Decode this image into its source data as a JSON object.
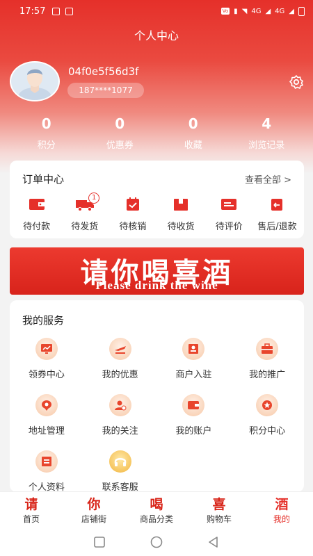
{
  "status_bar": {
    "time": "17:57",
    "network_labels": [
      "4G",
      "4G"
    ]
  },
  "page_title": "个人中心",
  "user": {
    "name": "04f0e5f56d3f",
    "phone": "187****1077"
  },
  "stats": [
    {
      "value": "0",
      "label": "积分"
    },
    {
      "value": "0",
      "label": "优惠券"
    },
    {
      "value": "0",
      "label": "收藏"
    },
    {
      "value": "4",
      "label": "浏览记录"
    }
  ],
  "orders": {
    "title": "订单中心",
    "see_all": "查看全部 >",
    "items": [
      {
        "label": "待付款",
        "icon": "wallet-icon"
      },
      {
        "label": "待发货",
        "icon": "truck-icon",
        "badge": "1"
      },
      {
        "label": "待核销",
        "icon": "calendar-check-icon"
      },
      {
        "label": "待收货",
        "icon": "box-icon"
      },
      {
        "label": "待评价",
        "icon": "message-icon"
      },
      {
        "label": "售后/退款",
        "icon": "return-icon"
      }
    ]
  },
  "banner": {
    "title": "请你喝喜酒",
    "subtitle": "Please drink the wine"
  },
  "services": {
    "title": "我的服务",
    "items": [
      {
        "label": "领券中心",
        "icon": "monitor-icon"
      },
      {
        "label": "我的优惠",
        "icon": "plane-icon"
      },
      {
        "label": "商户入驻",
        "icon": "id-card-icon"
      },
      {
        "label": "我的推广",
        "icon": "briefcase-icon"
      },
      {
        "label": "地址管理",
        "icon": "location-icon"
      },
      {
        "label": "我的关注",
        "icon": "user-check-icon"
      },
      {
        "label": "我的账户",
        "icon": "wallet-icon"
      },
      {
        "label": "积分中心",
        "icon": "medal-icon"
      },
      {
        "label": "个人资料",
        "icon": "profile-card-icon"
      },
      {
        "label": "联系客服",
        "icon": "headset-icon"
      }
    ]
  },
  "tabbar": [
    {
      "glyph": "请",
      "label": "首页"
    },
    {
      "glyph": "你",
      "label": "店铺街"
    },
    {
      "glyph": "喝",
      "label": "商品分类"
    },
    {
      "glyph": "喜",
      "label": "购物车"
    },
    {
      "glyph": "酒",
      "label": "我的",
      "active": true
    }
  ],
  "colors": {
    "primary": "#e5302a",
    "icon_accent": "#e8452c",
    "icon_bg": "#f7c9a8",
    "page_bg": "#f3f3f3"
  }
}
